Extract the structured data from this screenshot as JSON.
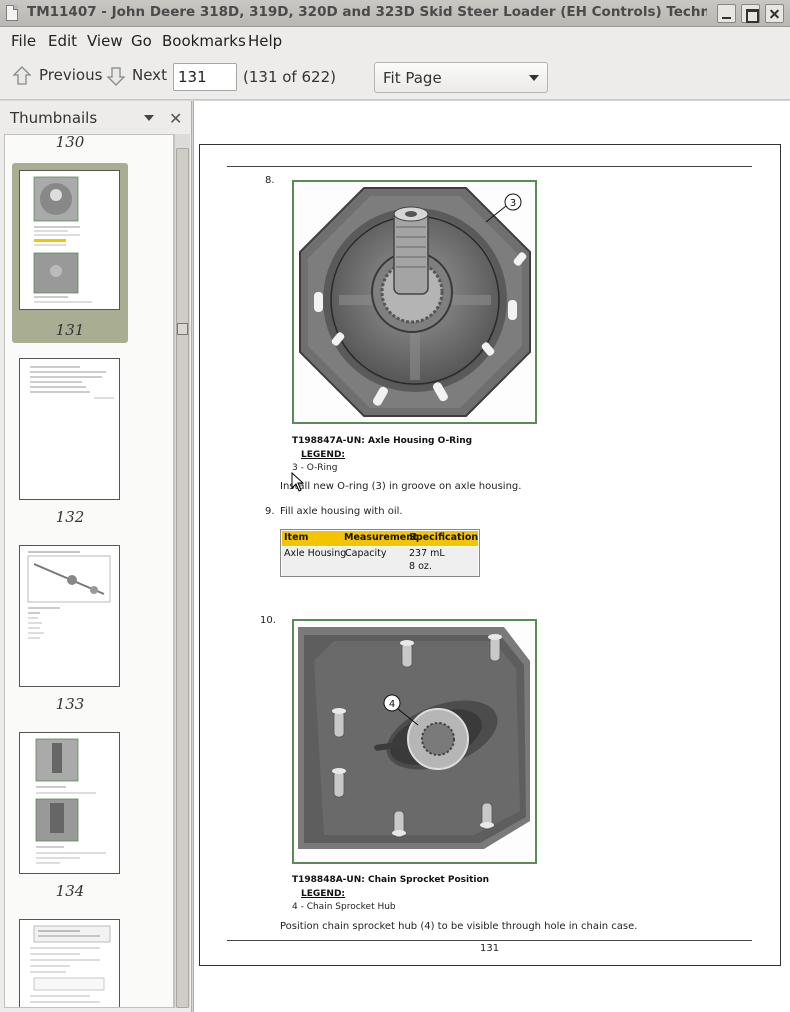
{
  "window": {
    "title": "TM11407 - John Deere 318D, 319D, 320D and 323D Skid Steer Loader (EH Controls) Technical Manual (",
    "buttons": [
      "minimize",
      "maximize",
      "close"
    ]
  },
  "menubar": {
    "items": [
      "File",
      "Edit",
      "View",
      "Go",
      "Bookmarks",
      "Help"
    ]
  },
  "toolbar": {
    "previous_label": "Previous",
    "next_label": "Next",
    "page_value": "131",
    "page_count": "(131 of 622)",
    "zoom_value": "Fit Page",
    "icons": {
      "previous": "up-arrow-icon",
      "next": "down-arrow-icon"
    }
  },
  "sidebar": {
    "title": "Thumbnails",
    "thumbnails": [
      {
        "page": "130"
      },
      {
        "page": "131",
        "selected": true
      },
      {
        "page": "132"
      },
      {
        "page": "133"
      },
      {
        "page": "134"
      }
    ]
  },
  "document": {
    "step8": {
      "num": "8.",
      "caption": "T198847A-UN: Axle Housing O-Ring",
      "legend_title": "LEGEND:",
      "legend_item": "3 - O-Ring",
      "callout": "3",
      "text": "Install new O-ring (3) in groove on axle housing."
    },
    "step9": {
      "num": "9.",
      "text": "Fill axle housing with oil.",
      "table": {
        "headers": [
          "Item",
          "Measurement",
          "Specification"
        ],
        "row": {
          "item": "Axle Housing",
          "measurement": "Capacity",
          "spec1": "237 mL",
          "spec2": "8 oz."
        }
      }
    },
    "step10": {
      "num": "10.",
      "caption": "T198848A-UN: Chain Sprocket Position",
      "legend_title": "LEGEND:",
      "legend_item": "4 - Chain Sprocket Hub",
      "callout": "4",
      "text": "Position chain sprocket hub (4) to be visible through hole in chain case."
    },
    "page_number": "131"
  },
  "colors": {
    "photo_border": "#5a8a56",
    "table_header": "#f4c400",
    "thumb_selected": "#a9ae93"
  }
}
